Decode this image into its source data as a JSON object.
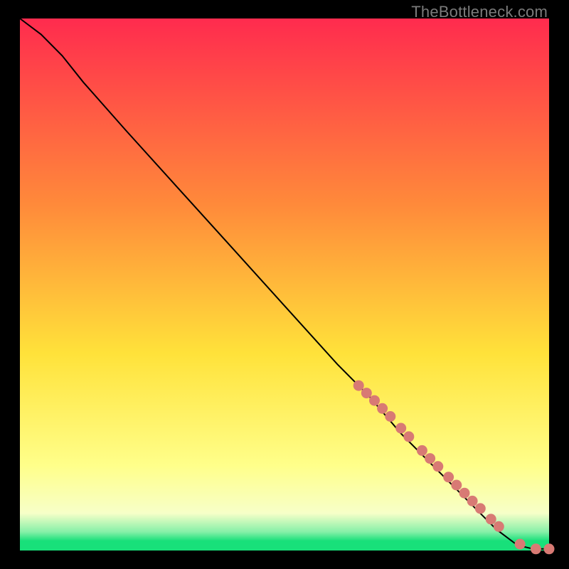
{
  "attribution": "TheBottleneck.com",
  "colors": {
    "top": "#ff2b4e",
    "orange": "#ff8a3a",
    "yellow": "#ffe23a",
    "pale": "#ffff8a",
    "cream": "#f7ffc8",
    "mint": "#86f0a8",
    "green": "#18e07a",
    "dot": "#d87a74"
  },
  "chart_data": {
    "type": "line",
    "title": "",
    "xlabel": "",
    "ylabel": "",
    "xlim": [
      0,
      100
    ],
    "ylim": [
      0,
      100
    ],
    "note": "Axes are implicit (no ticks or labels shown). Curve is read as percentage coordinates within the colored panel: x left→right 0–100, y bottom→top 0–100. Curve starts top-left, slight convex bend near top, then near-linear descent to bottom-right. Salmon dots cluster on lower-right segment.",
    "series": [
      {
        "name": "curve",
        "x": [
          0,
          4,
          8,
          12,
          20,
          30,
          40,
          50,
          60,
          66,
          72,
          78,
          82,
          86,
          90,
          94,
          97,
          100
        ],
        "y": [
          100,
          97,
          93,
          88,
          79,
          68,
          57,
          46,
          35,
          29,
          22,
          16,
          12,
          8,
          4,
          1,
          0.3,
          0.3
        ]
      }
    ],
    "points": {
      "name": "markers",
      "note": "Salmon dots on/near the curve in the lower-right region, plus two near the very bottom-right on the flat tail.",
      "x": [
        64,
        65.5,
        67,
        68.5,
        70,
        72,
        73.5,
        76,
        77.5,
        79,
        81,
        82.5,
        84,
        85.5,
        87,
        89,
        90.5,
        94.5,
        97.5,
        100
      ],
      "y": [
        31,
        29.6,
        28.2,
        26.7,
        25.2,
        23.0,
        21.4,
        18.8,
        17.3,
        15.8,
        13.8,
        12.3,
        10.8,
        9.3,
        7.9,
        5.9,
        4.5,
        1.2,
        0.3,
        0.3
      ]
    }
  }
}
